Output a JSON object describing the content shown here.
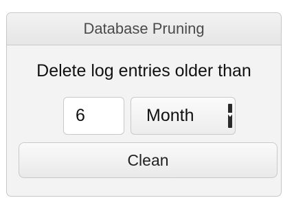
{
  "panel": {
    "title": "Database Pruning",
    "description": "Delete log entries older than",
    "age": {
      "value": "6"
    },
    "unit": {
      "selected": "Month"
    },
    "clean_label": "Clean"
  }
}
